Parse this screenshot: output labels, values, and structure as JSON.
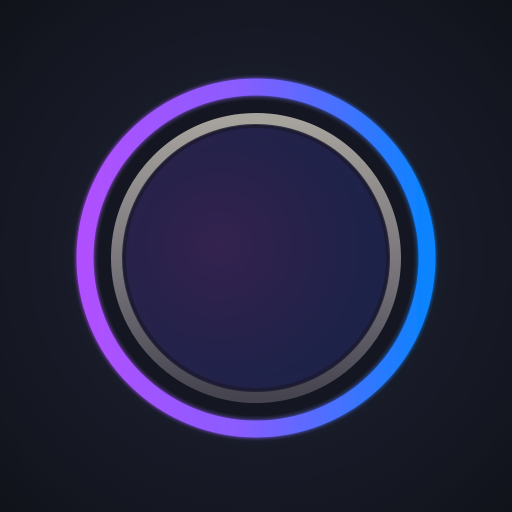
{
  "palette": {
    "background_edge": "#13151f",
    "background_mid": "#1a1d2b",
    "ring_purple": "#a64dff",
    "ring_mid": "#7a63ff",
    "ring_blue": "#0a84ff",
    "inner_ring_top": "#a8a59f",
    "inner_ring_bottom": "#4b4b55",
    "center_purple": "#30224f",
    "center_blue": "#1e2350"
  },
  "icons": {
    "main": "circular-ring-icon"
  }
}
